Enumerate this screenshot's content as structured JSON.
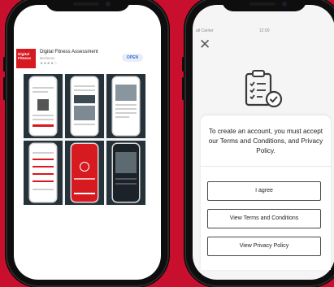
{
  "colors": {
    "background": "#c8102e",
    "brand_red": "#d71920",
    "open_blue": "#2f73d8"
  },
  "app_store": {
    "icon_text": "Digital Fitness",
    "app_name": "Digital Fitness Assessment",
    "category": "Business",
    "rating_stars": "★★★★☆",
    "open_label": "OPEN"
  },
  "signup": {
    "status_carrier": "all Carrier",
    "status_time": "12:00",
    "close_icon": "close-icon",
    "header_icon": "clipboard-check-icon",
    "message": "To create an account, you must accept our Terms and Conditions, and Privacy Policy.",
    "agree_label": "I agree",
    "terms_label": "View Terms and Conditions",
    "privacy_label": "View Privacy Policy"
  }
}
